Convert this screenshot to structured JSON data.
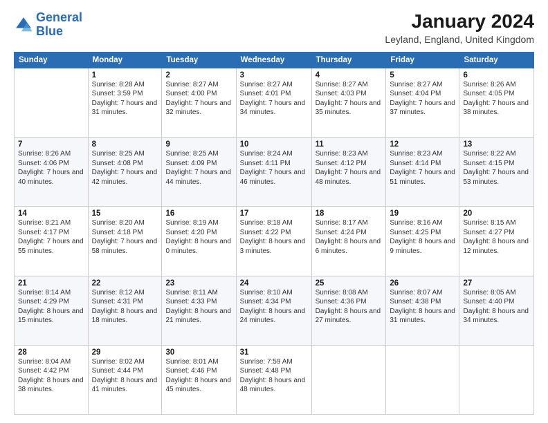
{
  "header": {
    "logo_general": "General",
    "logo_blue": "Blue",
    "month": "January 2024",
    "location": "Leyland, England, United Kingdom"
  },
  "weekdays": [
    "Sunday",
    "Monday",
    "Tuesday",
    "Wednesday",
    "Thursday",
    "Friday",
    "Saturday"
  ],
  "weeks": [
    [
      {
        "day": "",
        "sunrise": "",
        "sunset": "",
        "daylight": ""
      },
      {
        "day": "1",
        "sunrise": "Sunrise: 8:28 AM",
        "sunset": "Sunset: 3:59 PM",
        "daylight": "Daylight: 7 hours and 31 minutes."
      },
      {
        "day": "2",
        "sunrise": "Sunrise: 8:27 AM",
        "sunset": "Sunset: 4:00 PM",
        "daylight": "Daylight: 7 hours and 32 minutes."
      },
      {
        "day": "3",
        "sunrise": "Sunrise: 8:27 AM",
        "sunset": "Sunset: 4:01 PM",
        "daylight": "Daylight: 7 hours and 34 minutes."
      },
      {
        "day": "4",
        "sunrise": "Sunrise: 8:27 AM",
        "sunset": "Sunset: 4:03 PM",
        "daylight": "Daylight: 7 hours and 35 minutes."
      },
      {
        "day": "5",
        "sunrise": "Sunrise: 8:27 AM",
        "sunset": "Sunset: 4:04 PM",
        "daylight": "Daylight: 7 hours and 37 minutes."
      },
      {
        "day": "6",
        "sunrise": "Sunrise: 8:26 AM",
        "sunset": "Sunset: 4:05 PM",
        "daylight": "Daylight: 7 hours and 38 minutes."
      }
    ],
    [
      {
        "day": "7",
        "sunrise": "Sunrise: 8:26 AM",
        "sunset": "Sunset: 4:06 PM",
        "daylight": "Daylight: 7 hours and 40 minutes."
      },
      {
        "day": "8",
        "sunrise": "Sunrise: 8:25 AM",
        "sunset": "Sunset: 4:08 PM",
        "daylight": "Daylight: 7 hours and 42 minutes."
      },
      {
        "day": "9",
        "sunrise": "Sunrise: 8:25 AM",
        "sunset": "Sunset: 4:09 PM",
        "daylight": "Daylight: 7 hours and 44 minutes."
      },
      {
        "day": "10",
        "sunrise": "Sunrise: 8:24 AM",
        "sunset": "Sunset: 4:11 PM",
        "daylight": "Daylight: 7 hours and 46 minutes."
      },
      {
        "day": "11",
        "sunrise": "Sunrise: 8:23 AM",
        "sunset": "Sunset: 4:12 PM",
        "daylight": "Daylight: 7 hours and 48 minutes."
      },
      {
        "day": "12",
        "sunrise": "Sunrise: 8:23 AM",
        "sunset": "Sunset: 4:14 PM",
        "daylight": "Daylight: 7 hours and 51 minutes."
      },
      {
        "day": "13",
        "sunrise": "Sunrise: 8:22 AM",
        "sunset": "Sunset: 4:15 PM",
        "daylight": "Daylight: 7 hours and 53 minutes."
      }
    ],
    [
      {
        "day": "14",
        "sunrise": "Sunrise: 8:21 AM",
        "sunset": "Sunset: 4:17 PM",
        "daylight": "Daylight: 7 hours and 55 minutes."
      },
      {
        "day": "15",
        "sunrise": "Sunrise: 8:20 AM",
        "sunset": "Sunset: 4:18 PM",
        "daylight": "Daylight: 7 hours and 58 minutes."
      },
      {
        "day": "16",
        "sunrise": "Sunrise: 8:19 AM",
        "sunset": "Sunset: 4:20 PM",
        "daylight": "Daylight: 8 hours and 0 minutes."
      },
      {
        "day": "17",
        "sunrise": "Sunrise: 8:18 AM",
        "sunset": "Sunset: 4:22 PM",
        "daylight": "Daylight: 8 hours and 3 minutes."
      },
      {
        "day": "18",
        "sunrise": "Sunrise: 8:17 AM",
        "sunset": "Sunset: 4:24 PM",
        "daylight": "Daylight: 8 hours and 6 minutes."
      },
      {
        "day": "19",
        "sunrise": "Sunrise: 8:16 AM",
        "sunset": "Sunset: 4:25 PM",
        "daylight": "Daylight: 8 hours and 9 minutes."
      },
      {
        "day": "20",
        "sunrise": "Sunrise: 8:15 AM",
        "sunset": "Sunset: 4:27 PM",
        "daylight": "Daylight: 8 hours and 12 minutes."
      }
    ],
    [
      {
        "day": "21",
        "sunrise": "Sunrise: 8:14 AM",
        "sunset": "Sunset: 4:29 PM",
        "daylight": "Daylight: 8 hours and 15 minutes."
      },
      {
        "day": "22",
        "sunrise": "Sunrise: 8:12 AM",
        "sunset": "Sunset: 4:31 PM",
        "daylight": "Daylight: 8 hours and 18 minutes."
      },
      {
        "day": "23",
        "sunrise": "Sunrise: 8:11 AM",
        "sunset": "Sunset: 4:33 PM",
        "daylight": "Daylight: 8 hours and 21 minutes."
      },
      {
        "day": "24",
        "sunrise": "Sunrise: 8:10 AM",
        "sunset": "Sunset: 4:34 PM",
        "daylight": "Daylight: 8 hours and 24 minutes."
      },
      {
        "day": "25",
        "sunrise": "Sunrise: 8:08 AM",
        "sunset": "Sunset: 4:36 PM",
        "daylight": "Daylight: 8 hours and 27 minutes."
      },
      {
        "day": "26",
        "sunrise": "Sunrise: 8:07 AM",
        "sunset": "Sunset: 4:38 PM",
        "daylight": "Daylight: 8 hours and 31 minutes."
      },
      {
        "day": "27",
        "sunrise": "Sunrise: 8:05 AM",
        "sunset": "Sunset: 4:40 PM",
        "daylight": "Daylight: 8 hours and 34 minutes."
      }
    ],
    [
      {
        "day": "28",
        "sunrise": "Sunrise: 8:04 AM",
        "sunset": "Sunset: 4:42 PM",
        "daylight": "Daylight: 8 hours and 38 minutes."
      },
      {
        "day": "29",
        "sunrise": "Sunrise: 8:02 AM",
        "sunset": "Sunset: 4:44 PM",
        "daylight": "Daylight: 8 hours and 41 minutes."
      },
      {
        "day": "30",
        "sunrise": "Sunrise: 8:01 AM",
        "sunset": "Sunset: 4:46 PM",
        "daylight": "Daylight: 8 hours and 45 minutes."
      },
      {
        "day": "31",
        "sunrise": "Sunrise: 7:59 AM",
        "sunset": "Sunset: 4:48 PM",
        "daylight": "Daylight: 8 hours and 48 minutes."
      },
      {
        "day": "",
        "sunrise": "",
        "sunset": "",
        "daylight": ""
      },
      {
        "day": "",
        "sunrise": "",
        "sunset": "",
        "daylight": ""
      },
      {
        "day": "",
        "sunrise": "",
        "sunset": "",
        "daylight": ""
      }
    ]
  ]
}
